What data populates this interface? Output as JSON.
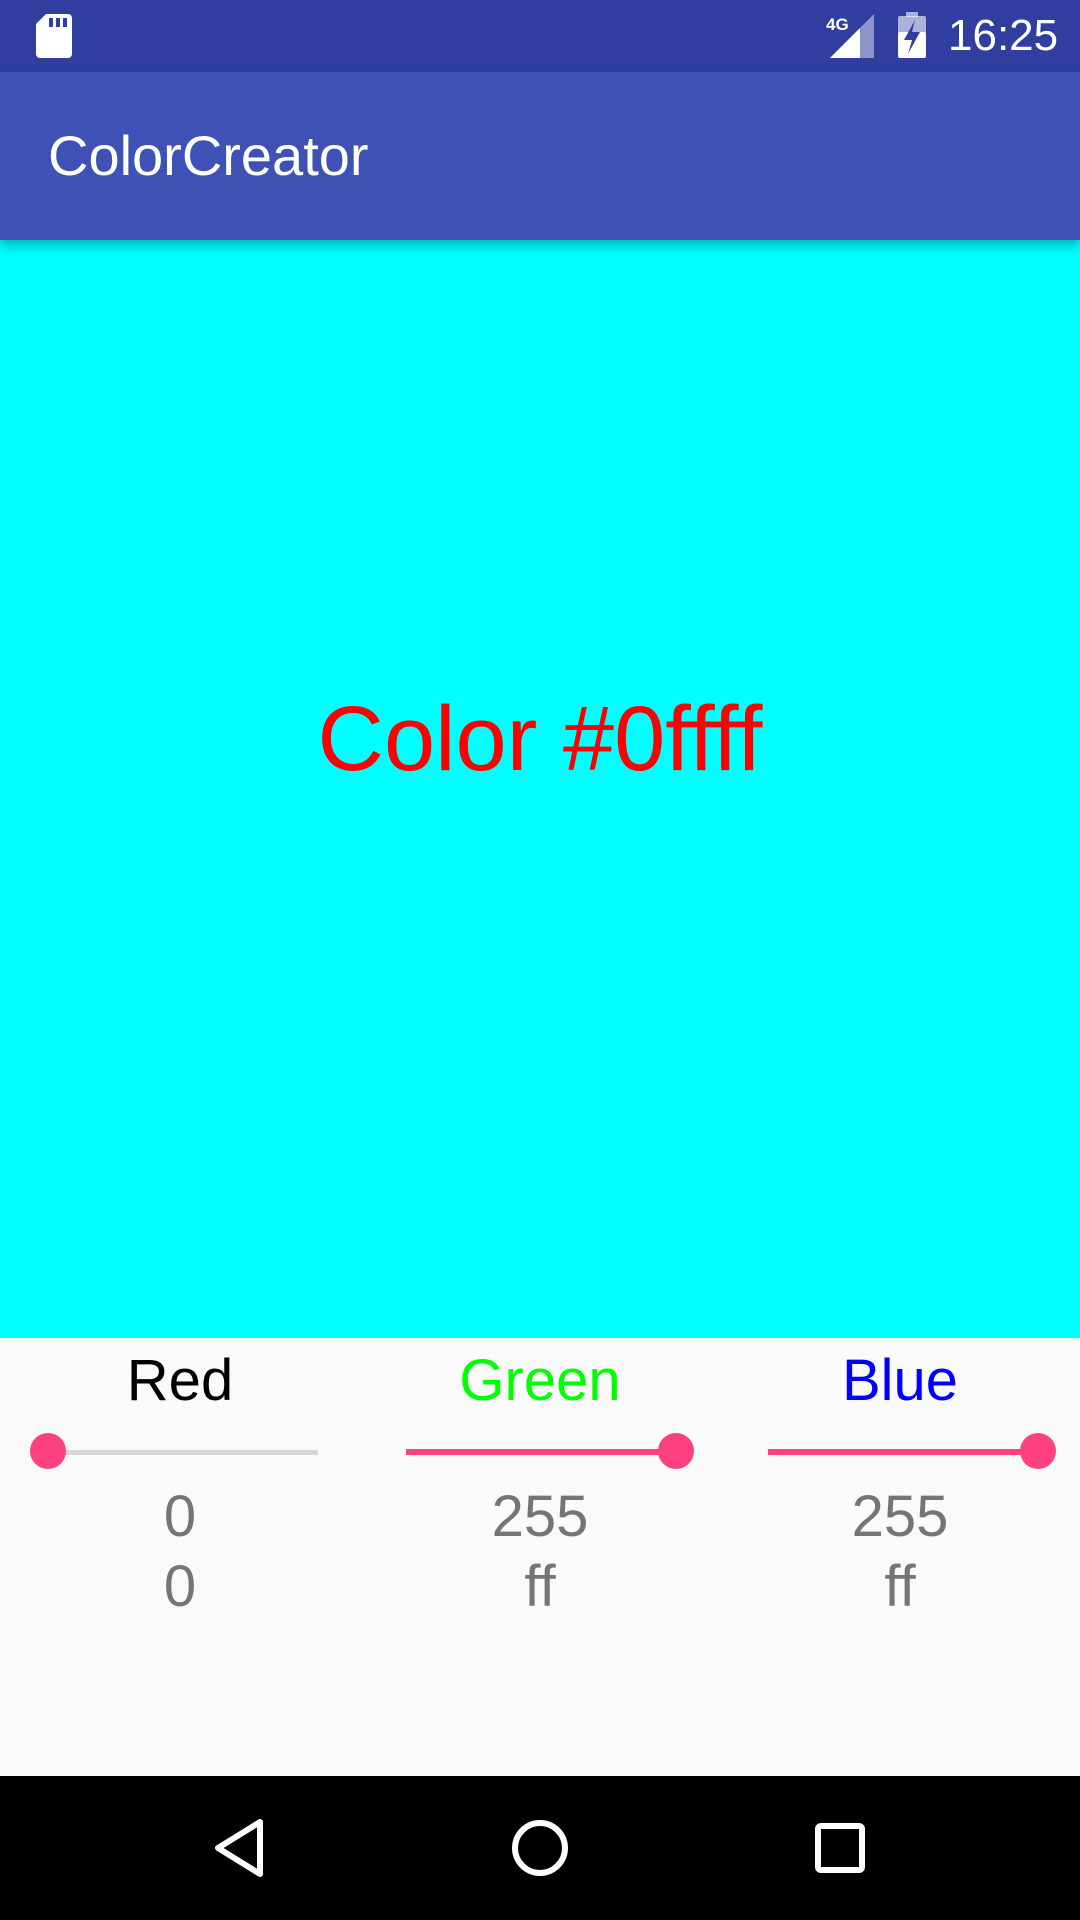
{
  "status_bar": {
    "time": "16:25",
    "network": "4G",
    "icons": [
      "sd-card-icon",
      "cell-signal-icon",
      "battery-charging-icon"
    ]
  },
  "app_bar": {
    "title": "ColorCreator"
  },
  "preview": {
    "text": "Color #0ffff",
    "background_color": "#00ffff",
    "text_color": "#ff0000"
  },
  "channels": [
    {
      "label": "Red",
      "label_color": "#000000",
      "value": 0,
      "decimal": "0",
      "hex": "0",
      "max": 255
    },
    {
      "label": "Green",
      "label_color": "#00ff00",
      "value": 255,
      "decimal": "255",
      "hex": "ff",
      "max": 255
    },
    {
      "label": "Blue",
      "label_color": "#0000ff",
      "value": 255,
      "decimal": "255",
      "hex": "ff",
      "max": 255
    }
  ],
  "colors": {
    "status_bar": "#303f9f",
    "app_bar": "#3f51b5",
    "accent": "#ff4081"
  },
  "nav_bar": {
    "icons": [
      "back-icon",
      "home-icon",
      "recents-icon"
    ]
  }
}
